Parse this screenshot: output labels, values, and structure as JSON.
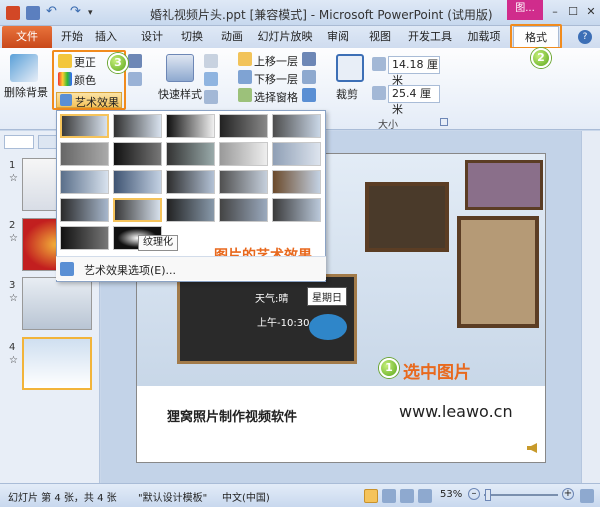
{
  "window": {
    "title": "婚礼视频片头.ppt [兼容模式] - Microsoft PowerPoint (试用版)",
    "context_label": "图...",
    "min": "–",
    "max": "☐",
    "close": "✕"
  },
  "tabs": [
    "文件",
    "开始",
    "插入",
    "设计",
    "切换",
    "动画",
    "幻灯片放映",
    "审阅",
    "视图",
    "开发工具",
    "加载项",
    "格式"
  ],
  "ribbon": {
    "remove_bg": "删除背景",
    "correct": "更正",
    "color": "颜色",
    "art_effects": "艺术效果",
    "quick_styles": "快速样式",
    "bring_forward": "上移一层",
    "send_backward": "下移一层",
    "selection_pane": "选择窗格",
    "crop": "裁剪",
    "height": "14.18 厘米",
    "width": "25.4 厘米",
    "size_group": "大小"
  },
  "gallery": {
    "tooltip": "纹理化",
    "options": "艺术效果选项(E)...",
    "caption": "图片的艺术效果"
  },
  "badges": {
    "one": "1",
    "two": "2",
    "three": "3"
  },
  "slides": {
    "numbers": [
      "1",
      "2",
      "3",
      "4"
    ],
    "star": "☆"
  },
  "slide": {
    "chalk_date": "星期日",
    "chalk_line1": "天气:晴",
    "chalk_line2": "上午-10:30",
    "select_caption": "选中图片",
    "company": "狸窝照片制作视频软件",
    "url": "www.leawo.cn"
  },
  "status": {
    "slide_info": "幻灯片 第 4 张，共 4 张",
    "theme": "\"默认设计模板\"",
    "language": "中文(中国)",
    "zoom": "53%"
  },
  "colors": {
    "file_tab": "#d9561f",
    "highlight": "#f18b1d",
    "caption": "#e8691e",
    "badge": "#5aa51c"
  }
}
